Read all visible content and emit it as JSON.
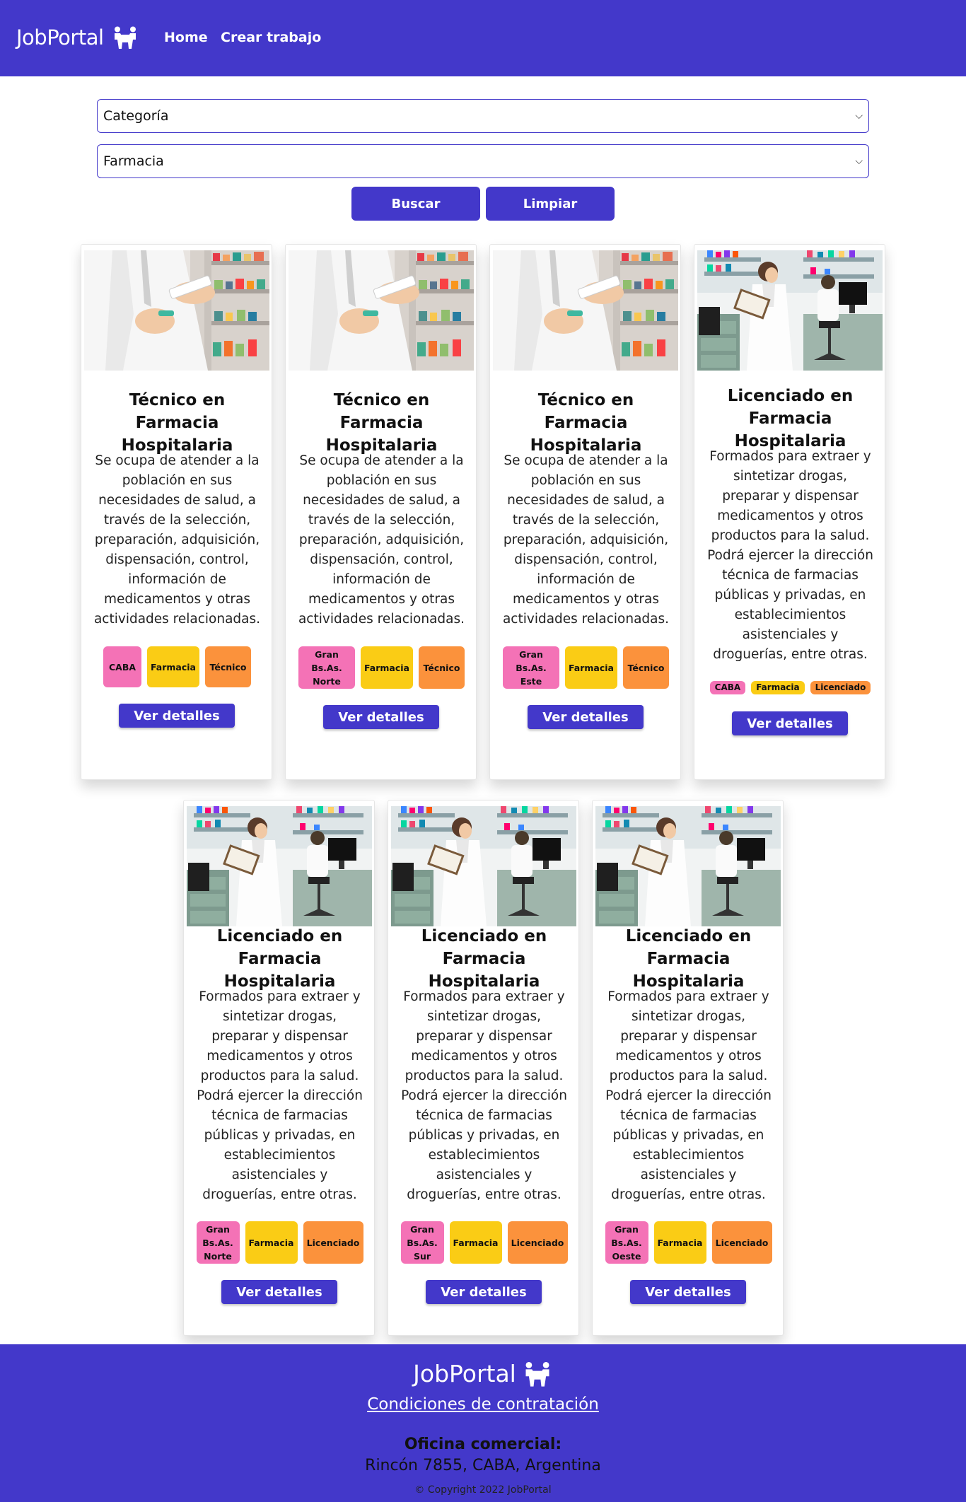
{
  "navbar": {
    "brand": "JobPortal",
    "brand_icon": "people-carry-icon",
    "links": [
      "Home",
      "Crear trabajo"
    ]
  },
  "filters": {
    "category_select": "Categoría",
    "subcategory_select": "Farmacia",
    "search_label": "Buscar",
    "clear_label": "Limpiar"
  },
  "cards": [
    {
      "image": "pharmacist-handing-medicine",
      "title": "Técnico en Farmacia Hospitalaria",
      "description": "Se ocupa de atender a la población en sus necesidades de salud, a través de la selección, preparación, adquisición, dispensación, control, información de medicamentos y otras actividades relacionadas.",
      "tags": [
        "CABA",
        "Farmacia",
        "Técnico"
      ],
      "button": "Ver detalles"
    },
    {
      "image": "pharmacist-handing-medicine",
      "title": "Técnico en Farmacia Hospitalaria",
      "description": "Se ocupa de atender a la población en sus necesidades de salud, a través de la selección, preparación, adquisición, dispensación, control, información de medicamentos y otras actividades relacionadas.",
      "tags": [
        "Gran Bs.As. Norte",
        "Farmacia",
        "Técnico"
      ],
      "button": "Ver detalles"
    },
    {
      "image": "pharmacist-handing-medicine",
      "title": "Técnico en Farmacia Hospitalaria",
      "description": "Se ocupa de atender a la población en sus necesidades de salud, a través de la selección, preparación, adquisición, dispensación, control, información de medicamentos y otras actividades relacionadas.",
      "tags": [
        "Gran Bs.As. Este",
        "Farmacia",
        "Técnico"
      ],
      "button": "Ver detalles"
    },
    {
      "image": "pharmacy-lab-workers",
      "title": "Licenciado en Farmacia Hospitalaria",
      "description": "Formados para extraer y sintetizar drogas, preparar y dispensar medicamentos y otros productos para la salud. Podrá ejercer la dirección técnica de farmacias públicas y privadas, en establecimientos asistenciales y droguerías, entre otras.",
      "tags": [
        "CABA",
        "Farmacia",
        "Licenciado"
      ],
      "button": "Ver detalles"
    },
    {
      "image": "pharmacy-lab-workers",
      "title": "Licenciado en Farmacia Hospitalaria",
      "description": "Formados para extraer y sintetizar drogas, preparar y dispensar medicamentos y otros productos para la salud. Podrá ejercer la dirección técnica de farmacias públicas y privadas, en establecimientos asistenciales y droguerías, entre otras.",
      "tags": [
        "Gran Bs.As. Norte",
        "Farmacia",
        "Licenciado"
      ],
      "button": "Ver detalles"
    },
    {
      "image": "pharmacy-lab-workers",
      "title": "Licenciado en Farmacia Hospitalaria",
      "description": "Formados para extraer y sintetizar drogas, preparar y dispensar medicamentos y otros productos para la salud. Podrá ejercer la dirección técnica de farmacias públicas y privadas, en establecimientos asistenciales y droguerías, entre otras.",
      "tags": [
        "Gran Bs.As. Sur",
        "Farmacia",
        "Licenciado"
      ],
      "button": "Ver detalles"
    },
    {
      "image": "pharmacy-lab-workers",
      "title": "Licenciado en Farmacia Hospitalaria",
      "description": "Formados para extraer y sintetizar drogas, preparar y dispensar medicamentos y otros productos para la salud. Podrá ejercer la dirección técnica de farmacias públicas y privadas, en establecimientos asistenciales y droguerías, entre otras.",
      "tags": [
        "Gran Bs.As. Oeste",
        "Farmacia",
        "Licenciado"
      ],
      "button": "Ver detalles"
    }
  ],
  "footer": {
    "brand": "JobPortal",
    "terms_link": "Condiciones de contratación",
    "office_label": "Oficina comercial:",
    "office_address": "Rincón 7855, CABA, Argentina",
    "copyright": "© Copyright 2022 JobPortal"
  },
  "colors": {
    "primary": "#4338ca",
    "tag_location": "#f472b6",
    "tag_category": "#facc15",
    "tag_level": "#fb923c"
  }
}
